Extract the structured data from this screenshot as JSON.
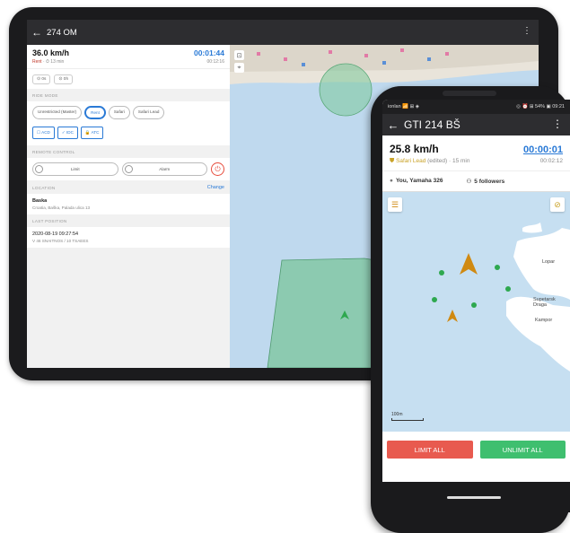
{
  "tablet": {
    "appbar": {
      "back_icon": "arrow-left-icon",
      "title": "274 OM"
    },
    "speed": "36.0 km/h",
    "timer": "00:01:44",
    "sub_left_status": "Rent",
    "sub_left_time": "· ⏱ 13 min",
    "sub_right": "00:12:16",
    "chips": [
      "⊙ 0s",
      "⊙ 0h"
    ],
    "sections": {
      "ride_mode": "RIDE MODE",
      "remote_control": "REMOTE CONTROL",
      "location": "LOCATION",
      "last_position": "LAST POSITION"
    },
    "ride_modes": [
      "Unrestricted (Master)",
      "Rent",
      "Safari",
      "Safari Lead"
    ],
    "ride_mode_selected": "Rent",
    "mode_buttons": [
      "☐ ACD",
      "✓ IDC",
      "🔒 ATC"
    ],
    "remote": {
      "limit": "Limit",
      "alarm": "Alarm"
    },
    "location_change": "Change",
    "location": {
      "name": "Baska",
      "address": "Croatia, Baška, Palada ulica 13"
    },
    "last_position": {
      "time": "2020-08-19 09:27:54",
      "info": "V 46 SNAITNOS / 10 TSAEES"
    }
  },
  "phone": {
    "status_left": "ionlan 📶 ⊞ ◈",
    "status_right": "◎ ⏰ ⊞ 54% ▣ 09:21",
    "appbar": {
      "back_icon": "arrow-left-icon",
      "title": "GTI 214 BŠ"
    },
    "speed": "25.8 km/h",
    "timer": "00:00:01",
    "mode": "Safari Lead",
    "mode_note": "(edited)",
    "mode_time": "· 15 min",
    "time_right": "00:02:12",
    "owner": "You, Yamaha 326",
    "followers": "5 followers",
    "map_labels": {
      "l1": "Lopar",
      "l2": "Supetarsk\nDraga",
      "l3": "Kampor"
    },
    "scale": "100m",
    "limit_all": "LIMIT ALL",
    "unlimit_all": "UNLIMIT ALL"
  },
  "colors": {
    "accent": "#2a7ad6",
    "red_button": "#e85a4f",
    "green_button": "#3fbf6f",
    "lead_marker": "#d08a12",
    "follower_marker": "#2ea84f"
  }
}
